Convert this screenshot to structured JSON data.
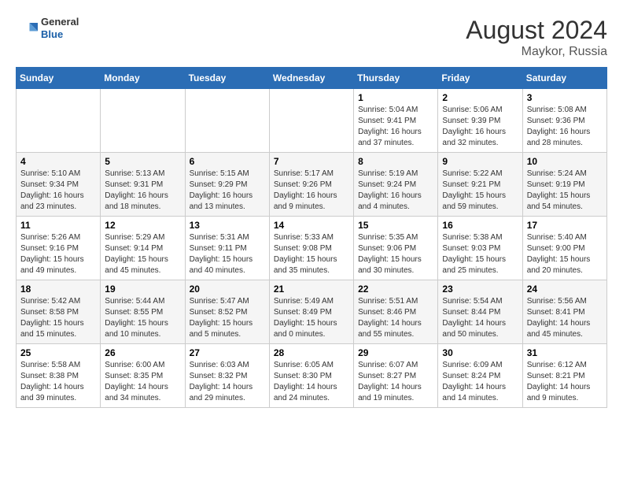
{
  "header": {
    "logo": {
      "general": "General",
      "blue": "Blue"
    },
    "title": "August 2024",
    "location": "Maykor, Russia"
  },
  "weekdays": [
    "Sunday",
    "Monday",
    "Tuesday",
    "Wednesday",
    "Thursday",
    "Friday",
    "Saturday"
  ],
  "weeks": [
    [
      {
        "day": "",
        "content": ""
      },
      {
        "day": "",
        "content": ""
      },
      {
        "day": "",
        "content": ""
      },
      {
        "day": "",
        "content": ""
      },
      {
        "day": "1",
        "content": "Sunrise: 5:04 AM\nSunset: 9:41 PM\nDaylight: 16 hours\nand 37 minutes."
      },
      {
        "day": "2",
        "content": "Sunrise: 5:06 AM\nSunset: 9:39 PM\nDaylight: 16 hours\nand 32 minutes."
      },
      {
        "day": "3",
        "content": "Sunrise: 5:08 AM\nSunset: 9:36 PM\nDaylight: 16 hours\nand 28 minutes."
      }
    ],
    [
      {
        "day": "4",
        "content": "Sunrise: 5:10 AM\nSunset: 9:34 PM\nDaylight: 16 hours\nand 23 minutes."
      },
      {
        "day": "5",
        "content": "Sunrise: 5:13 AM\nSunset: 9:31 PM\nDaylight: 16 hours\nand 18 minutes."
      },
      {
        "day": "6",
        "content": "Sunrise: 5:15 AM\nSunset: 9:29 PM\nDaylight: 16 hours\nand 13 minutes."
      },
      {
        "day": "7",
        "content": "Sunrise: 5:17 AM\nSunset: 9:26 PM\nDaylight: 16 hours\nand 9 minutes."
      },
      {
        "day": "8",
        "content": "Sunrise: 5:19 AM\nSunset: 9:24 PM\nDaylight: 16 hours\nand 4 minutes."
      },
      {
        "day": "9",
        "content": "Sunrise: 5:22 AM\nSunset: 9:21 PM\nDaylight: 15 hours\nand 59 minutes."
      },
      {
        "day": "10",
        "content": "Sunrise: 5:24 AM\nSunset: 9:19 PM\nDaylight: 15 hours\nand 54 minutes."
      }
    ],
    [
      {
        "day": "11",
        "content": "Sunrise: 5:26 AM\nSunset: 9:16 PM\nDaylight: 15 hours\nand 49 minutes."
      },
      {
        "day": "12",
        "content": "Sunrise: 5:29 AM\nSunset: 9:14 PM\nDaylight: 15 hours\nand 45 minutes."
      },
      {
        "day": "13",
        "content": "Sunrise: 5:31 AM\nSunset: 9:11 PM\nDaylight: 15 hours\nand 40 minutes."
      },
      {
        "day": "14",
        "content": "Sunrise: 5:33 AM\nSunset: 9:08 PM\nDaylight: 15 hours\nand 35 minutes."
      },
      {
        "day": "15",
        "content": "Sunrise: 5:35 AM\nSunset: 9:06 PM\nDaylight: 15 hours\nand 30 minutes."
      },
      {
        "day": "16",
        "content": "Sunrise: 5:38 AM\nSunset: 9:03 PM\nDaylight: 15 hours\nand 25 minutes."
      },
      {
        "day": "17",
        "content": "Sunrise: 5:40 AM\nSunset: 9:00 PM\nDaylight: 15 hours\nand 20 minutes."
      }
    ],
    [
      {
        "day": "18",
        "content": "Sunrise: 5:42 AM\nSunset: 8:58 PM\nDaylight: 15 hours\nand 15 minutes."
      },
      {
        "day": "19",
        "content": "Sunrise: 5:44 AM\nSunset: 8:55 PM\nDaylight: 15 hours\nand 10 minutes."
      },
      {
        "day": "20",
        "content": "Sunrise: 5:47 AM\nSunset: 8:52 PM\nDaylight: 15 hours\nand 5 minutes."
      },
      {
        "day": "21",
        "content": "Sunrise: 5:49 AM\nSunset: 8:49 PM\nDaylight: 15 hours\nand 0 minutes."
      },
      {
        "day": "22",
        "content": "Sunrise: 5:51 AM\nSunset: 8:46 PM\nDaylight: 14 hours\nand 55 minutes."
      },
      {
        "day": "23",
        "content": "Sunrise: 5:54 AM\nSunset: 8:44 PM\nDaylight: 14 hours\nand 50 minutes."
      },
      {
        "day": "24",
        "content": "Sunrise: 5:56 AM\nSunset: 8:41 PM\nDaylight: 14 hours\nand 45 minutes."
      }
    ],
    [
      {
        "day": "25",
        "content": "Sunrise: 5:58 AM\nSunset: 8:38 PM\nDaylight: 14 hours\nand 39 minutes."
      },
      {
        "day": "26",
        "content": "Sunrise: 6:00 AM\nSunset: 8:35 PM\nDaylight: 14 hours\nand 34 minutes."
      },
      {
        "day": "27",
        "content": "Sunrise: 6:03 AM\nSunset: 8:32 PM\nDaylight: 14 hours\nand 29 minutes."
      },
      {
        "day": "28",
        "content": "Sunrise: 6:05 AM\nSunset: 8:30 PM\nDaylight: 14 hours\nand 24 minutes."
      },
      {
        "day": "29",
        "content": "Sunrise: 6:07 AM\nSunset: 8:27 PM\nDaylight: 14 hours\nand 19 minutes."
      },
      {
        "day": "30",
        "content": "Sunrise: 6:09 AM\nSunset: 8:24 PM\nDaylight: 14 hours\nand 14 minutes."
      },
      {
        "day": "31",
        "content": "Sunrise: 6:12 AM\nSunset: 8:21 PM\nDaylight: 14 hours\nand 9 minutes."
      }
    ]
  ]
}
